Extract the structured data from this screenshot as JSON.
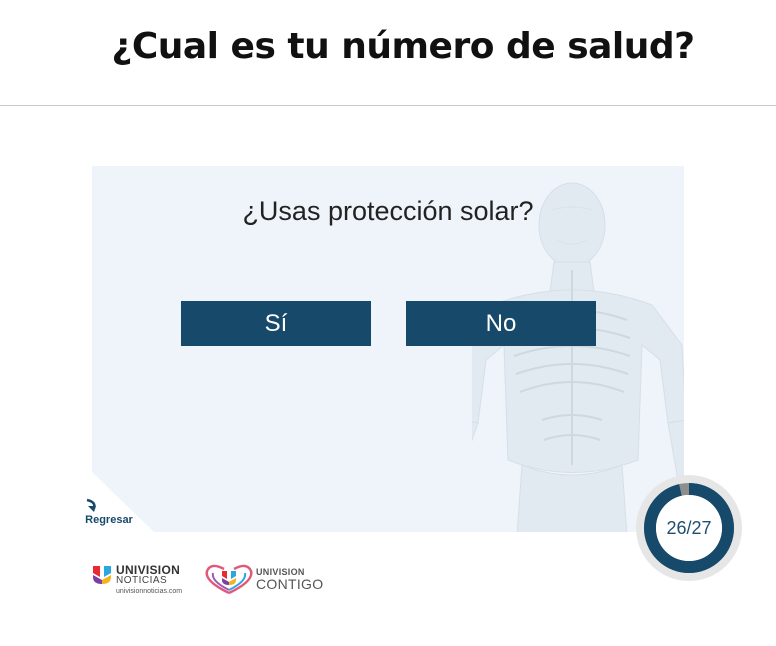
{
  "header": {
    "title": "¿Cual es tu número de salud?"
  },
  "quiz": {
    "question": "¿Usas protección solar?",
    "answers": [
      {
        "label": "Sí"
      },
      {
        "label": "No"
      }
    ]
  },
  "navigation": {
    "back_label": "Regresar",
    "back_icon": "back-arrow-icon"
  },
  "progress": {
    "text": "26/27",
    "current": 26,
    "total": 27
  },
  "logos": {
    "noticias": {
      "brand": "UNIVISION",
      "sub": "NOTICIAS",
      "url": "univisionnoticias.com"
    },
    "contigo": {
      "brand": "UNIVISION",
      "sub": "CONTIGO"
    }
  },
  "colors": {
    "button": "#174a6a",
    "panel": "#eef4f9",
    "progress_fill": "#174a6a",
    "progress_track": "#8e8e8e"
  }
}
